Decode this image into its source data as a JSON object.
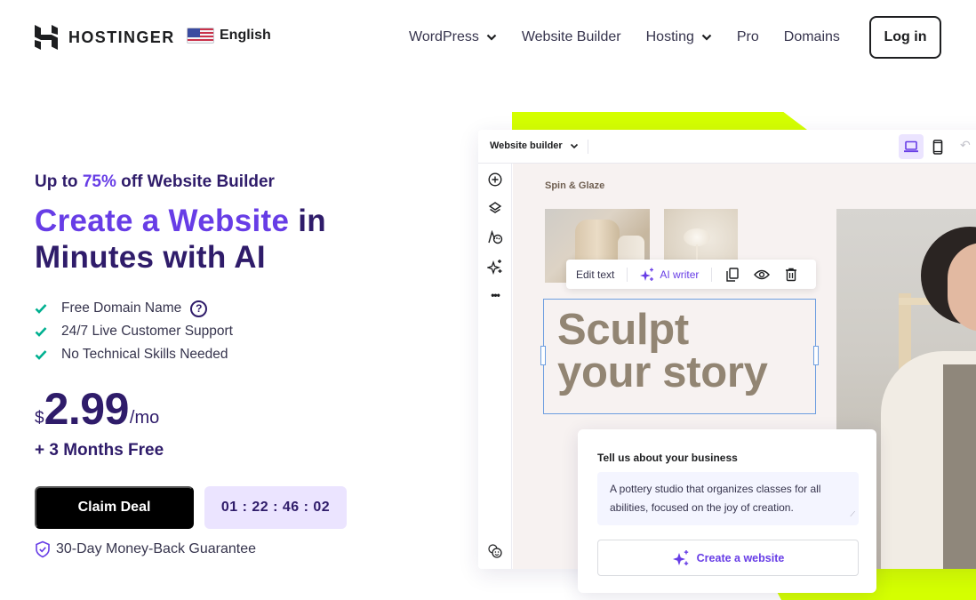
{
  "header": {
    "brand": "HOSTINGER",
    "language": "English",
    "nav": [
      {
        "label": "WordPress",
        "has_dropdown": true
      },
      {
        "label": "Website Builder",
        "has_dropdown": false
      },
      {
        "label": "Hosting",
        "has_dropdown": true
      },
      {
        "label": "Pro",
        "has_dropdown": false
      },
      {
        "label": "Domains",
        "has_dropdown": false
      }
    ],
    "login_label": "Log in"
  },
  "hero": {
    "promo_prefix": "Up to ",
    "promo_accent": "75%",
    "promo_suffix": " off Website Builder",
    "title_accent": "Create a Website",
    "title_rest_1": " in",
    "title_line_2": "Minutes with AI",
    "features": [
      "Free Domain Name",
      "24/7 Live Customer Support",
      "No Technical Skills Needed"
    ],
    "help_symbol": "?",
    "price_currency": "$",
    "price_amount": "2.99",
    "price_period": "/mo",
    "bonus": "+ 3 Months Free",
    "cta_label": "Claim Deal",
    "countdown": "01 : 22 : 46 : 02",
    "guarantee": "30-Day Money-Back Guarantee"
  },
  "builder": {
    "title": "Website builder",
    "undo_symbol": "↶",
    "side_more": "•••",
    "site_name": "Spin & Glaze",
    "toolbar": {
      "edit_text": "Edit text",
      "ai_writer": "AI writer"
    },
    "headline_line_1": "Sculpt",
    "headline_line_2": "your story",
    "prompt": {
      "label": "Tell us about your business",
      "value": "A pottery studio that organizes classes for all abilities, focused on the joy of creation.",
      "button_label": "Create a website"
    }
  },
  "colors": {
    "brand_purple": "#673de6",
    "dark_navy": "#2f1c6a",
    "lime": "#d4ff00",
    "check_green": "#00b090",
    "timer_bg": "#ebe4ff"
  }
}
